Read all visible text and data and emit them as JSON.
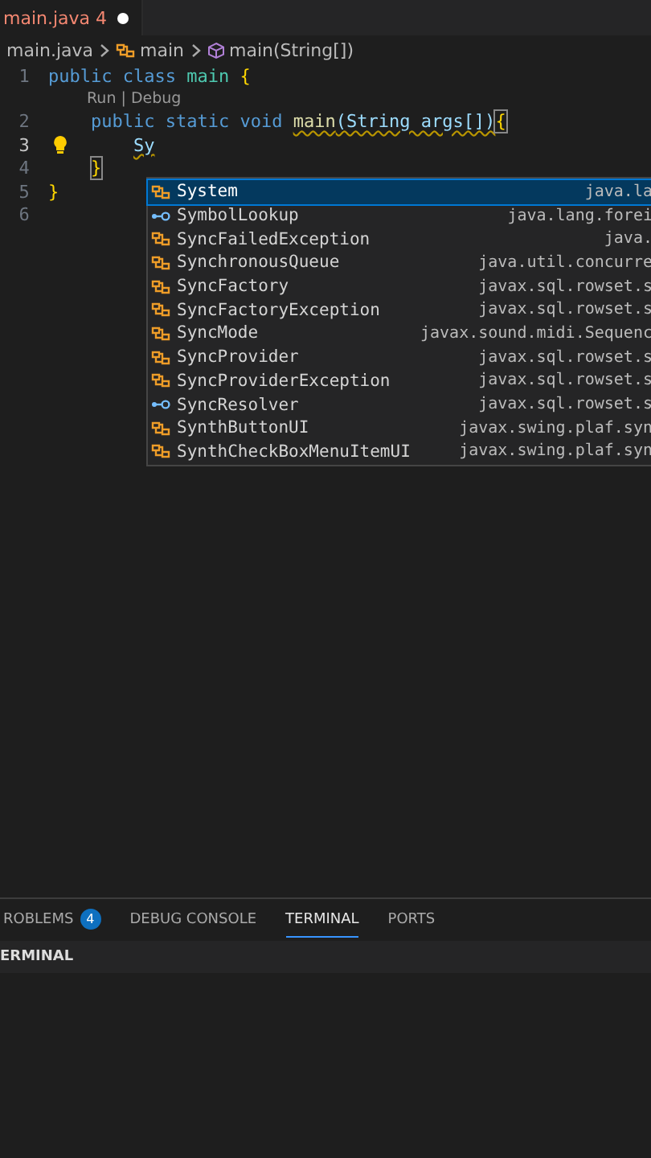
{
  "tab": {
    "label": "main.java",
    "problems": "4",
    "modified": true
  },
  "breadcrumb": [
    {
      "kind": "file",
      "label": "main.java"
    },
    {
      "kind": "class",
      "label": "main"
    },
    {
      "kind": "method",
      "label": "main(String[])"
    }
  ],
  "code_lines": [
    {
      "number": "1",
      "active": false,
      "tokens": [
        {
          "kind": "keyword",
          "text": "public class "
        },
        {
          "kind": "type",
          "text": "main "
        },
        {
          "kind": "brace",
          "text": "{"
        }
      ]
    },
    {
      "number": "2",
      "active": false,
      "codelens": "Run | Debug",
      "tokens": [
        {
          "kind": "keyword",
          "text": "    public static void "
        },
        {
          "kind": "func",
          "text": "main",
          "squiggly": true
        },
        {
          "kind": "plain",
          "text": "(String args[])",
          "squiggly": true
        },
        {
          "kind": "brace",
          "text": "{",
          "matched": true
        }
      ]
    },
    {
      "number": "3",
      "active": true,
      "lightbulb": true,
      "tokens": [
        {
          "kind": "plain",
          "text": "        Sy",
          "squiggly": true
        }
      ]
    },
    {
      "number": "4",
      "active": false,
      "tokens": [
        {
          "kind": "brace",
          "text": "    }",
          "matched": true
        }
      ]
    },
    {
      "number": "5",
      "active": false,
      "tokens": [
        {
          "kind": "brace",
          "text": "}"
        }
      ]
    },
    {
      "number": "6",
      "active": false
    }
  ],
  "suggestions": [
    {
      "kind": "class",
      "label": "System",
      "detail": "java.la",
      "selected": true
    },
    {
      "kind": "interface",
      "label": "SymbolLookup",
      "detail": "java.lang.forei",
      "selected": false
    },
    {
      "kind": "class",
      "label": "SyncFailedException",
      "detail": "java.",
      "selected": false
    },
    {
      "kind": "class",
      "label": "SynchronousQueue",
      "detail": "java.util.concurre",
      "selected": false
    },
    {
      "kind": "class",
      "label": "SyncFactory",
      "detail": "javax.sql.rowset.s",
      "selected": false
    },
    {
      "kind": "class",
      "label": "SyncFactoryException",
      "detail": "javax.sql.rowset.s",
      "selected": false
    },
    {
      "kind": "class",
      "label": "SyncMode",
      "detail": "javax.sound.midi.Sequenc",
      "selected": false
    },
    {
      "kind": "class",
      "label": "SyncProvider",
      "detail": "javax.sql.rowset.s",
      "selected": false
    },
    {
      "kind": "class",
      "label": "SyncProviderException",
      "detail": "javax.sql.rowset.s",
      "selected": false
    },
    {
      "kind": "interface",
      "label": "SyncResolver",
      "detail": "javax.sql.rowset.s",
      "selected": false
    },
    {
      "kind": "class",
      "label": "SynthButtonUI",
      "detail": "javax.swing.plaf.syn",
      "selected": false
    },
    {
      "kind": "class",
      "label": "SynthCheckBoxMenuItemUI",
      "detail": "javax.swing.plaf.syn",
      "selected": false
    }
  ],
  "panel": {
    "tabs": [
      {
        "label": "ROBLEMS",
        "badge": "4",
        "selected": false
      },
      {
        "label": "DEBUG CONSOLE",
        "selected": false
      },
      {
        "label": "TERMINAL",
        "selected": true
      },
      {
        "label": "PORTS",
        "selected": false
      }
    ],
    "header": "ERMINAL"
  }
}
